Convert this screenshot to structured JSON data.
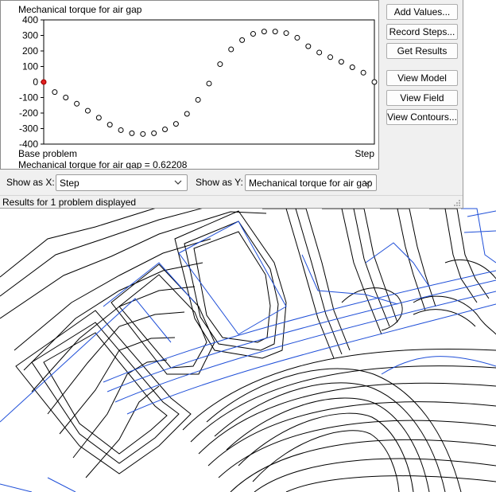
{
  "chart_data": {
    "type": "scatter",
    "title": "Mechanical torque for air gap",
    "xlabel": "Step",
    "ylabel": "",
    "x_left_label": "Base problem",
    "x": [
      0,
      1,
      2,
      3,
      4,
      5,
      6,
      7,
      8,
      9,
      10,
      11,
      12,
      13,
      14,
      15,
      16,
      17,
      18,
      19,
      20,
      21,
      22,
      23,
      24,
      25,
      26,
      27,
      28,
      29,
      30
    ],
    "y": [
      0,
      -65,
      -100,
      -140,
      -185,
      -230,
      -275,
      -310,
      -330,
      -335,
      -330,
      -305,
      -270,
      -205,
      -115,
      -10,
      115,
      210,
      270,
      310,
      325,
      325,
      315,
      285,
      230,
      190,
      160,
      130,
      95,
      60,
      0
    ],
    "xlim": [
      0,
      30
    ],
    "ylim": [
      -400,
      400
    ],
    "yticks": [
      400,
      300,
      200,
      100,
      0,
      -100,
      -200,
      -300,
      -400
    ],
    "selected_index": 0,
    "marker_color": "#ffffff",
    "selected_color": "#e02020",
    "grid": false
  },
  "plot": {
    "readout": "Mechanical torque for air gap = 0.62208"
  },
  "buttons": {
    "add_values": "Add Values...",
    "record_steps": "Record Steps...",
    "get_results": "Get Results",
    "view_model": "View Model",
    "view_field": "View Field",
    "view_contours": "View Contours..."
  },
  "controls": {
    "show_as_x_label": "Show as X:",
    "show_as_x_value": "Step",
    "show_as_y_label": "Show as Y:",
    "show_as_y_value": "Mechanical torque for air gap"
  },
  "status": {
    "text": "Results for 1 problem displayed"
  },
  "colors": {
    "contour": "#000000",
    "mesh_boundary": "#1f4fd8",
    "window_bg": "#f0f0f0"
  }
}
